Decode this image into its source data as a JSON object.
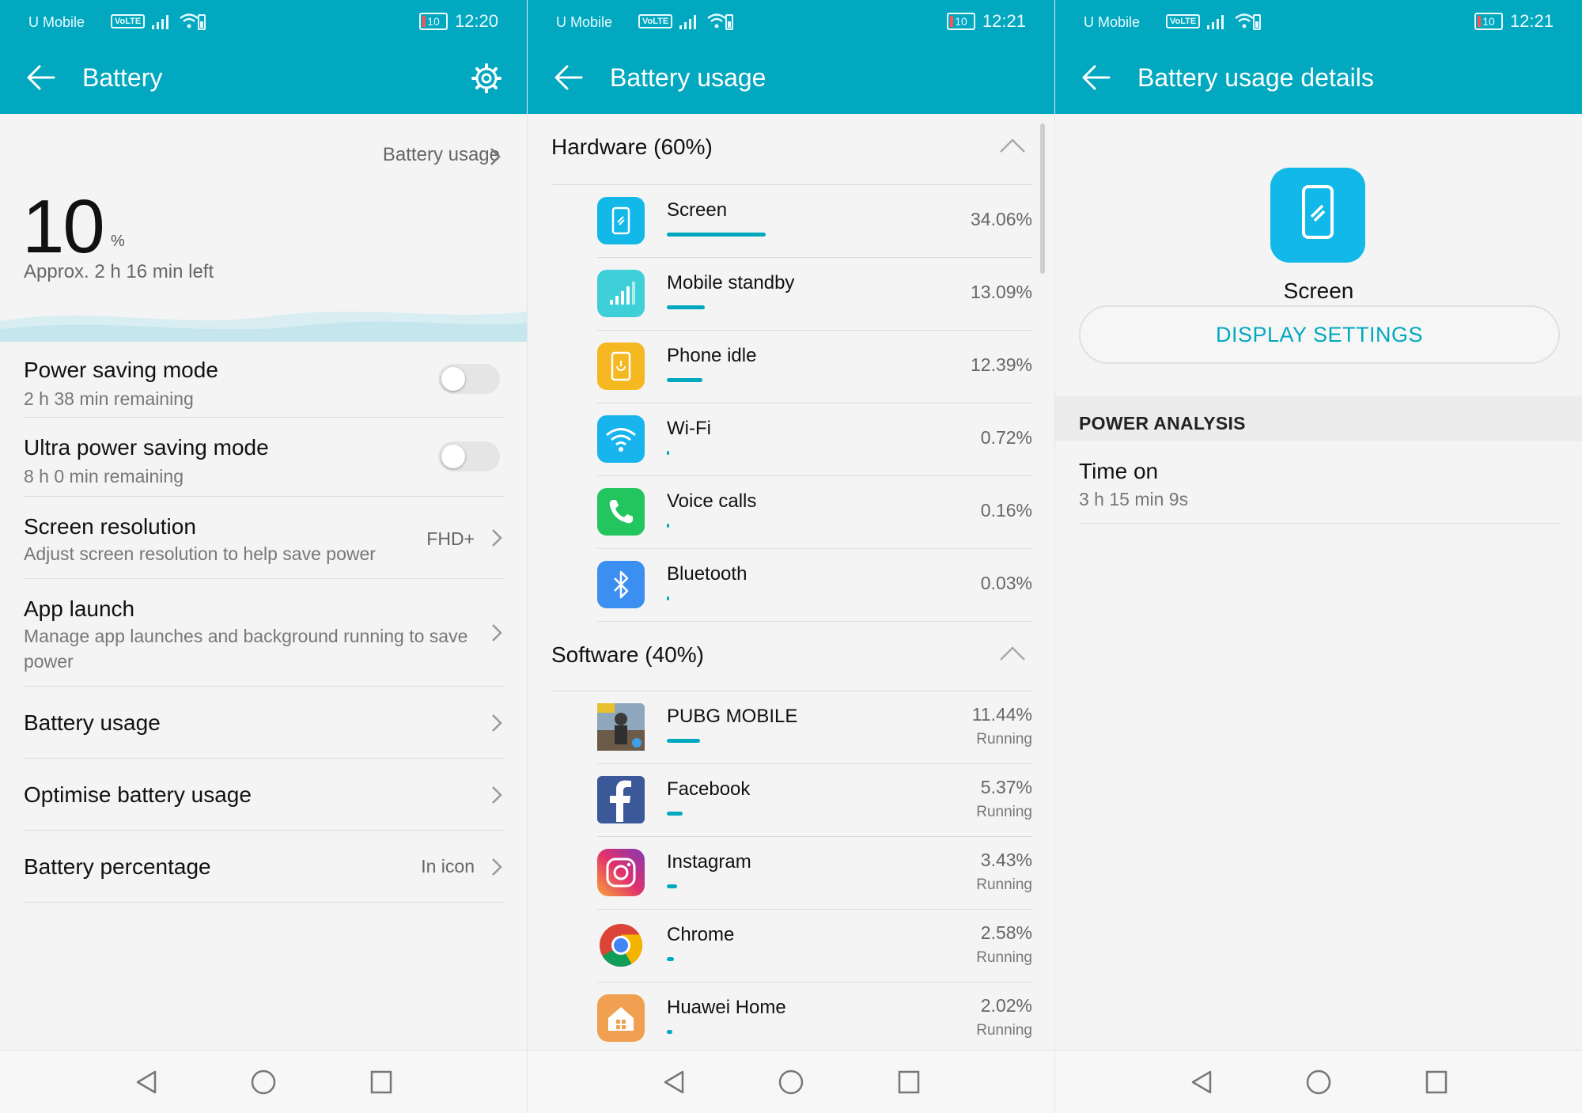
{
  "status_bar": {
    "carrier": "U Mobile",
    "volte": "VoLTE",
    "battery_level": "10",
    "clock_1": "12:20",
    "clock_2": "12:21",
    "clock_3": "12:21"
  },
  "screen1": {
    "title": "Battery",
    "battery_usage_link": "Battery usage",
    "percent_value": "10",
    "percent_sign": "%",
    "approx": "Approx. 2 h 16 min left",
    "rows": [
      {
        "title": "Power saving mode",
        "subtitle": "2 h 38 min remaining",
        "toggle_on": false
      },
      {
        "title": "Ultra power saving mode",
        "subtitle": "8 h 0 min remaining",
        "toggle_on": false
      },
      {
        "title": "Screen resolution",
        "subtitle": "Adjust screen resolution to help save power",
        "value": "FHD+"
      },
      {
        "title": "App launch",
        "subtitle_line1": "Manage app launches and background running to save",
        "subtitle_line2": "power"
      },
      {
        "title": "Battery usage"
      },
      {
        "title": "Optimise battery usage"
      },
      {
        "title": "Battery percentage",
        "value": "In icon"
      }
    ]
  },
  "screen2": {
    "title": "Battery usage",
    "hardware_header": "Hardware (60%)",
    "software_header": "Software (40%)",
    "hardware": [
      {
        "name": "Screen",
        "percent": "34.06%",
        "fraction": 0.3406,
        "icon": "screen-icon",
        "color": "#12b8e8"
      },
      {
        "name": "Mobile standby",
        "percent": "13.09%",
        "fraction": 0.1309,
        "icon": "signal-icon",
        "color": "#3fcfd8"
      },
      {
        "name": "Phone idle",
        "percent": "12.39%",
        "fraction": 0.1239,
        "icon": "phone-idle-icon",
        "color": "#f6b820"
      },
      {
        "name": "Wi-Fi",
        "percent": "0.72%",
        "fraction": 0.0072,
        "icon": "wifi-icon",
        "color": "#18b4ee"
      },
      {
        "name": "Voice calls",
        "percent": "0.16%",
        "fraction": 0.0016,
        "icon": "phone-icon",
        "color": "#22c55e"
      },
      {
        "name": "Bluetooth",
        "percent": "0.03%",
        "fraction": 0.0003,
        "icon": "bluetooth-icon",
        "color": "#3b8ff0"
      }
    ],
    "software": [
      {
        "name": "PUBG MOBILE",
        "percent": "11.44%",
        "fraction": 0.1144,
        "status": "Running",
        "icon": "pubg-icon"
      },
      {
        "name": "Facebook",
        "percent": "5.37%",
        "fraction": 0.0537,
        "status": "Running",
        "icon": "facebook-icon"
      },
      {
        "name": "Instagram",
        "percent": "3.43%",
        "fraction": 0.0343,
        "status": "Running",
        "icon": "instagram-icon"
      },
      {
        "name": "Chrome",
        "percent": "2.58%",
        "fraction": 0.0258,
        "status": "Running",
        "icon": "chrome-icon"
      },
      {
        "name": "Huawei Home",
        "percent": "2.02%",
        "fraction": 0.0202,
        "status": "Running",
        "icon": "home-icon"
      }
    ]
  },
  "screen3": {
    "title": "Battery usage details",
    "app_name": "Screen",
    "button": "DISPLAY SETTINGS",
    "section": "POWER ANALYSIS",
    "time_on_label": "Time on",
    "time_on_value": "3 h 15 min 9s"
  },
  "colors": {
    "accent": "#02a8c0",
    "background": "#f4f4f4"
  }
}
